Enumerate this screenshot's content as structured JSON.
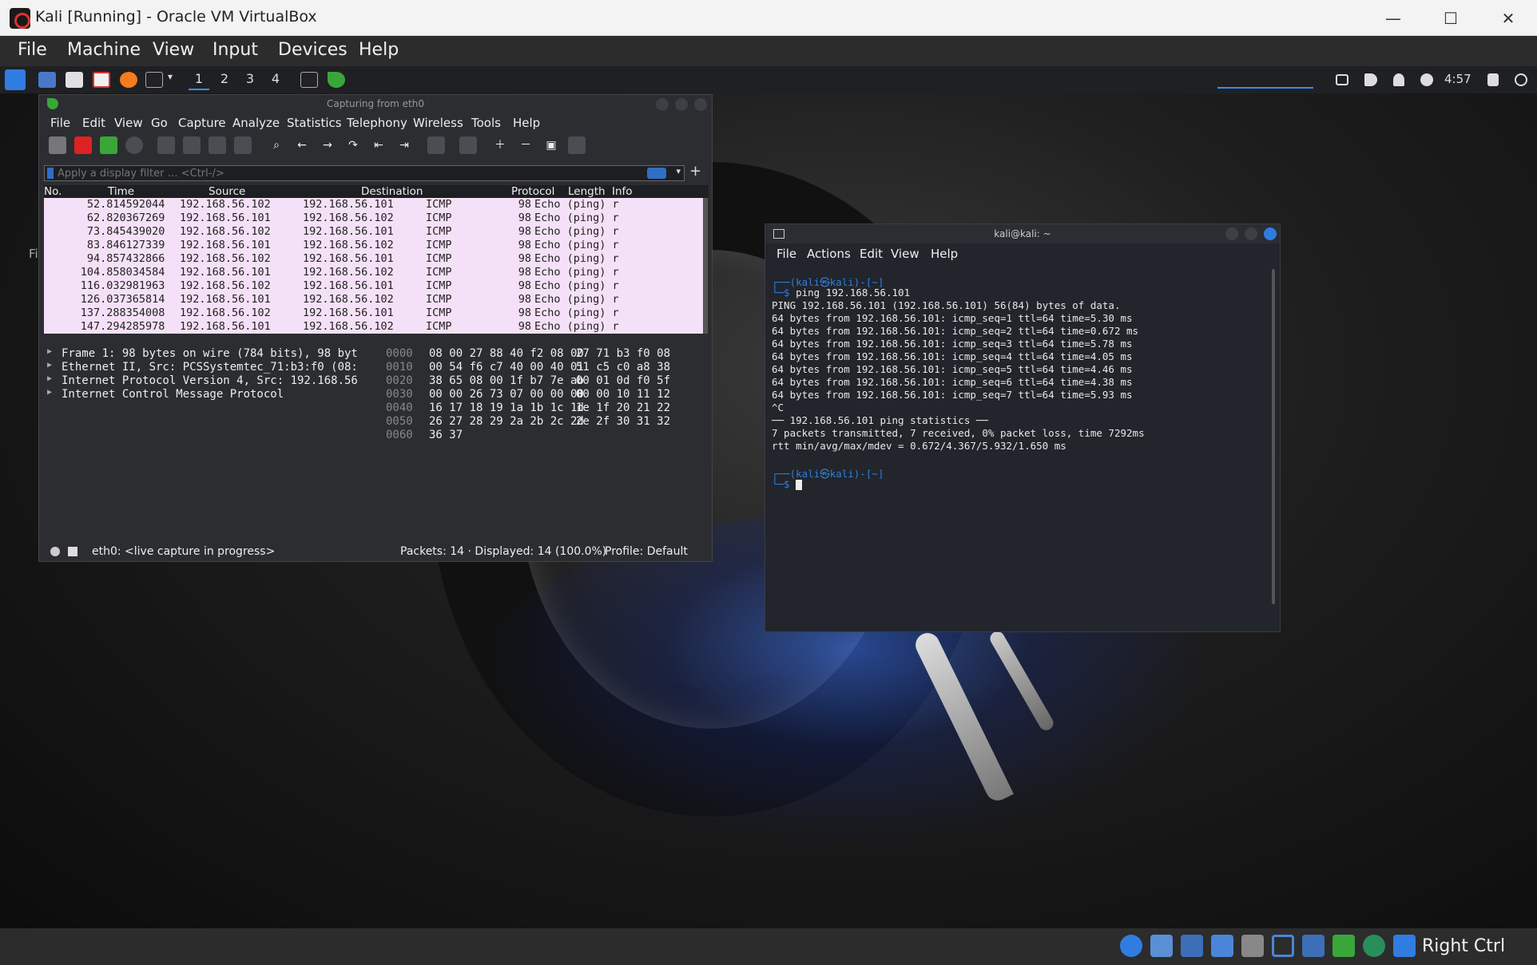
{
  "host": {
    "title": "Kali [Running] - Oracle VM VirtualBox",
    "minimize": "—",
    "maximize": "☐",
    "close": "✕",
    "menu": [
      "File",
      "Machine",
      "View",
      "Input",
      "Devices",
      "Help"
    ],
    "host_key": "Right Ctrl"
  },
  "kali_panel": {
    "workspaces": [
      "1",
      "2",
      "3",
      "4"
    ],
    "clock": "4:57"
  },
  "desktop_partial_label": "Fi",
  "wireshark": {
    "title": "Capturing from eth0",
    "menu": [
      "File",
      "Edit",
      "View",
      "Go",
      "Capture",
      "Analyze",
      "Statistics",
      "Telephony",
      "Wireless",
      "Tools",
      "Help"
    ],
    "filter_placeholder": "Apply a display filter … <Ctrl-/>",
    "add_filter": "+",
    "columns": [
      "No.",
      "Time",
      "Source",
      "Destination",
      "Protocol",
      "Length",
      "Info"
    ],
    "packets": [
      {
        "no": "5",
        "time": "2.814592044",
        "src": "192.168.56.102",
        "dst": "192.168.56.101",
        "proto": "ICMP",
        "len": "98",
        "info": "Echo (ping) r"
      },
      {
        "no": "6",
        "time": "2.820367269",
        "src": "192.168.56.101",
        "dst": "192.168.56.102",
        "proto": "ICMP",
        "len": "98",
        "info": "Echo (ping) r"
      },
      {
        "no": "7",
        "time": "3.845439020",
        "src": "192.168.56.102",
        "dst": "192.168.56.101",
        "proto": "ICMP",
        "len": "98",
        "info": "Echo (ping) r"
      },
      {
        "no": "8",
        "time": "3.846127339",
        "src": "192.168.56.101",
        "dst": "192.168.56.102",
        "proto": "ICMP",
        "len": "98",
        "info": "Echo (ping) r"
      },
      {
        "no": "9",
        "time": "4.857432866",
        "src": "192.168.56.102",
        "dst": "192.168.56.101",
        "proto": "ICMP",
        "len": "98",
        "info": "Echo (ping) r"
      },
      {
        "no": "10",
        "time": "4.858034584",
        "src": "192.168.56.101",
        "dst": "192.168.56.102",
        "proto": "ICMP",
        "len": "98",
        "info": "Echo (ping) r"
      },
      {
        "no": "11",
        "time": "6.032981963",
        "src": "192.168.56.102",
        "dst": "192.168.56.101",
        "proto": "ICMP",
        "len": "98",
        "info": "Echo (ping) r"
      },
      {
        "no": "12",
        "time": "6.037365814",
        "src": "192.168.56.101",
        "dst": "192.168.56.102",
        "proto": "ICMP",
        "len": "98",
        "info": "Echo (ping) r"
      },
      {
        "no": "13",
        "time": "7.288354008",
        "src": "192.168.56.102",
        "dst": "192.168.56.101",
        "proto": "ICMP",
        "len": "98",
        "info": "Echo (ping) r"
      },
      {
        "no": "14",
        "time": "7.294285978",
        "src": "192.168.56.101",
        "dst": "192.168.56.102",
        "proto": "ICMP",
        "len": "98",
        "info": "Echo (ping) r"
      }
    ],
    "details": [
      "Frame 1: 98 bytes on wire (784 bits), 98 byt",
      "Ethernet II, Src: PCSSystemtec_71:b3:f0 (08:",
      "Internet Protocol Version 4, Src: 192.168.56",
      "Internet Control Message Protocol"
    ],
    "hex": [
      {
        "off": "0000",
        "b1": "08 00 27 88 40 f2 08 00",
        "b2": "27 71 b3 f0 08"
      },
      {
        "off": "0010",
        "b1": "00 54 f6 c7 40 00 40 01",
        "b2": "51 c5 c0 a8 38"
      },
      {
        "off": "0020",
        "b1": "38 65 08 00 1f b7 7e ab",
        "b2": "00 01 0d f0 5f"
      },
      {
        "off": "0030",
        "b1": "00 00 26 73 07 00 00 00",
        "b2": "00 00 10 11 12"
      },
      {
        "off": "0040",
        "b1": "16 17 18 19 1a 1b 1c 1d",
        "b2": "1e 1f 20 21 22"
      },
      {
        "off": "0050",
        "b1": "26 27 28 29 2a 2b 2c 2d",
        "b2": "2e 2f 30 31 32"
      },
      {
        "off": "0060",
        "b1": "36 37",
        "b2": ""
      }
    ],
    "status": {
      "interface": "eth0: <live capture in progress>",
      "packets": "Packets: 14 · Displayed: 14 (100.0%)",
      "profile": "Profile: Default"
    }
  },
  "terminal": {
    "title": "kali@kali: ~",
    "menu": [
      "File",
      "Actions",
      "Edit",
      "View",
      "Help"
    ],
    "prompt_line1": "┌──(kali㉿kali)-[~]",
    "prompt_line2": "└─$ ",
    "command": "ping 192.168.56.101",
    "output": [
      "PING 192.168.56.101 (192.168.56.101) 56(84) bytes of data.",
      "64 bytes from 192.168.56.101: icmp_seq=1 ttl=64 time=5.30 ms",
      "64 bytes from 192.168.56.101: icmp_seq=2 ttl=64 time=0.672 ms",
      "64 bytes from 192.168.56.101: icmp_seq=3 ttl=64 time=5.78 ms",
      "64 bytes from 192.168.56.101: icmp_seq=4 ttl=64 time=4.05 ms",
      "64 bytes from 192.168.56.101: icmp_seq=5 ttl=64 time=4.46 ms",
      "64 bytes from 192.168.56.101: icmp_seq=6 ttl=64 time=4.38 ms",
      "64 bytes from 192.168.56.101: icmp_seq=7 ttl=64 time=5.93 ms",
      "^C",
      "── 192.168.56.101 ping statistics ──",
      "7 packets transmitted, 7 received, 0% packet loss, time 7292ms",
      "rtt min/avg/max/mdev = 0.672/4.367/5.932/1.650 ms"
    ]
  },
  "colors": {
    "packet_row_bg": "#f5e1f7",
    "prompt_blue": "#2f7de1",
    "accent": "#3a8ee6"
  }
}
